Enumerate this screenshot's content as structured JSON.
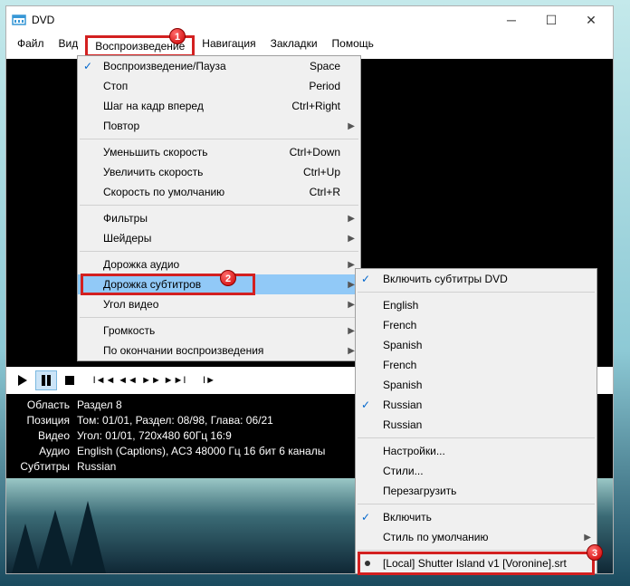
{
  "window": {
    "title": "DVD"
  },
  "menubar": [
    "Файл",
    "Вид",
    "Воспроизведение",
    "Навигация",
    "Закладки",
    "Помощь"
  ],
  "badges": {
    "b1": "1",
    "b2": "2",
    "b3": "3"
  },
  "menu": {
    "play_pause": {
      "label": "Воспроизведение/Пауза",
      "accel": "Space"
    },
    "stop": {
      "label": "Стоп",
      "accel": "Period"
    },
    "step": {
      "label": "Шаг на кадр вперед",
      "accel": "Ctrl+Right"
    },
    "repeat": {
      "label": "Повтор"
    },
    "speed_down": {
      "label": "Уменьшить скорость",
      "accel": "Ctrl+Down"
    },
    "speed_up": {
      "label": "Увеличить скорость",
      "accel": "Ctrl+Up"
    },
    "speed_def": {
      "label": "Скорость по умолчанию",
      "accel": "Ctrl+R"
    },
    "filters": {
      "label": "Фильтры"
    },
    "shaders": {
      "label": "Шейдеры"
    },
    "audio_track": {
      "label": "Дорожка аудио"
    },
    "sub_track": {
      "label": "Дорожка субтитров"
    },
    "angle": {
      "label": "Угол видео"
    },
    "volume": {
      "label": "Громкость"
    },
    "after": {
      "label": "По окончании воспроизведения"
    }
  },
  "submenu": {
    "enable": "Включить субтитры DVD",
    "lang1": "English",
    "lang2": "French",
    "lang3": "Spanish",
    "lang4": "French",
    "lang5": "Spanish",
    "lang6": "Russian",
    "lang7": "Russian",
    "settings": "Настройки...",
    "styles": "Стили...",
    "reload": "Перезагрузить",
    "enable2": "Включить",
    "default_style": "Стиль по умолчанию",
    "local_file": "[Local] Shutter Island v1 [Voronine].srt"
  },
  "status": {
    "region_label": "Область",
    "region_val": "Раздел 8",
    "pos_label": "Позиция",
    "pos_val": "Том: 01/01, Раздел: 08/98, Глава: 06/21",
    "video_label": "Видео",
    "video_val": "Угол: 01/01, 720x480 60Гц 16:9",
    "audio_label": "Аудио",
    "audio_val": "English (Captions), AC3 48000 Гц 16 бит 6 каналы",
    "sub_label": "Субтитры",
    "sub_val": "Russian"
  }
}
